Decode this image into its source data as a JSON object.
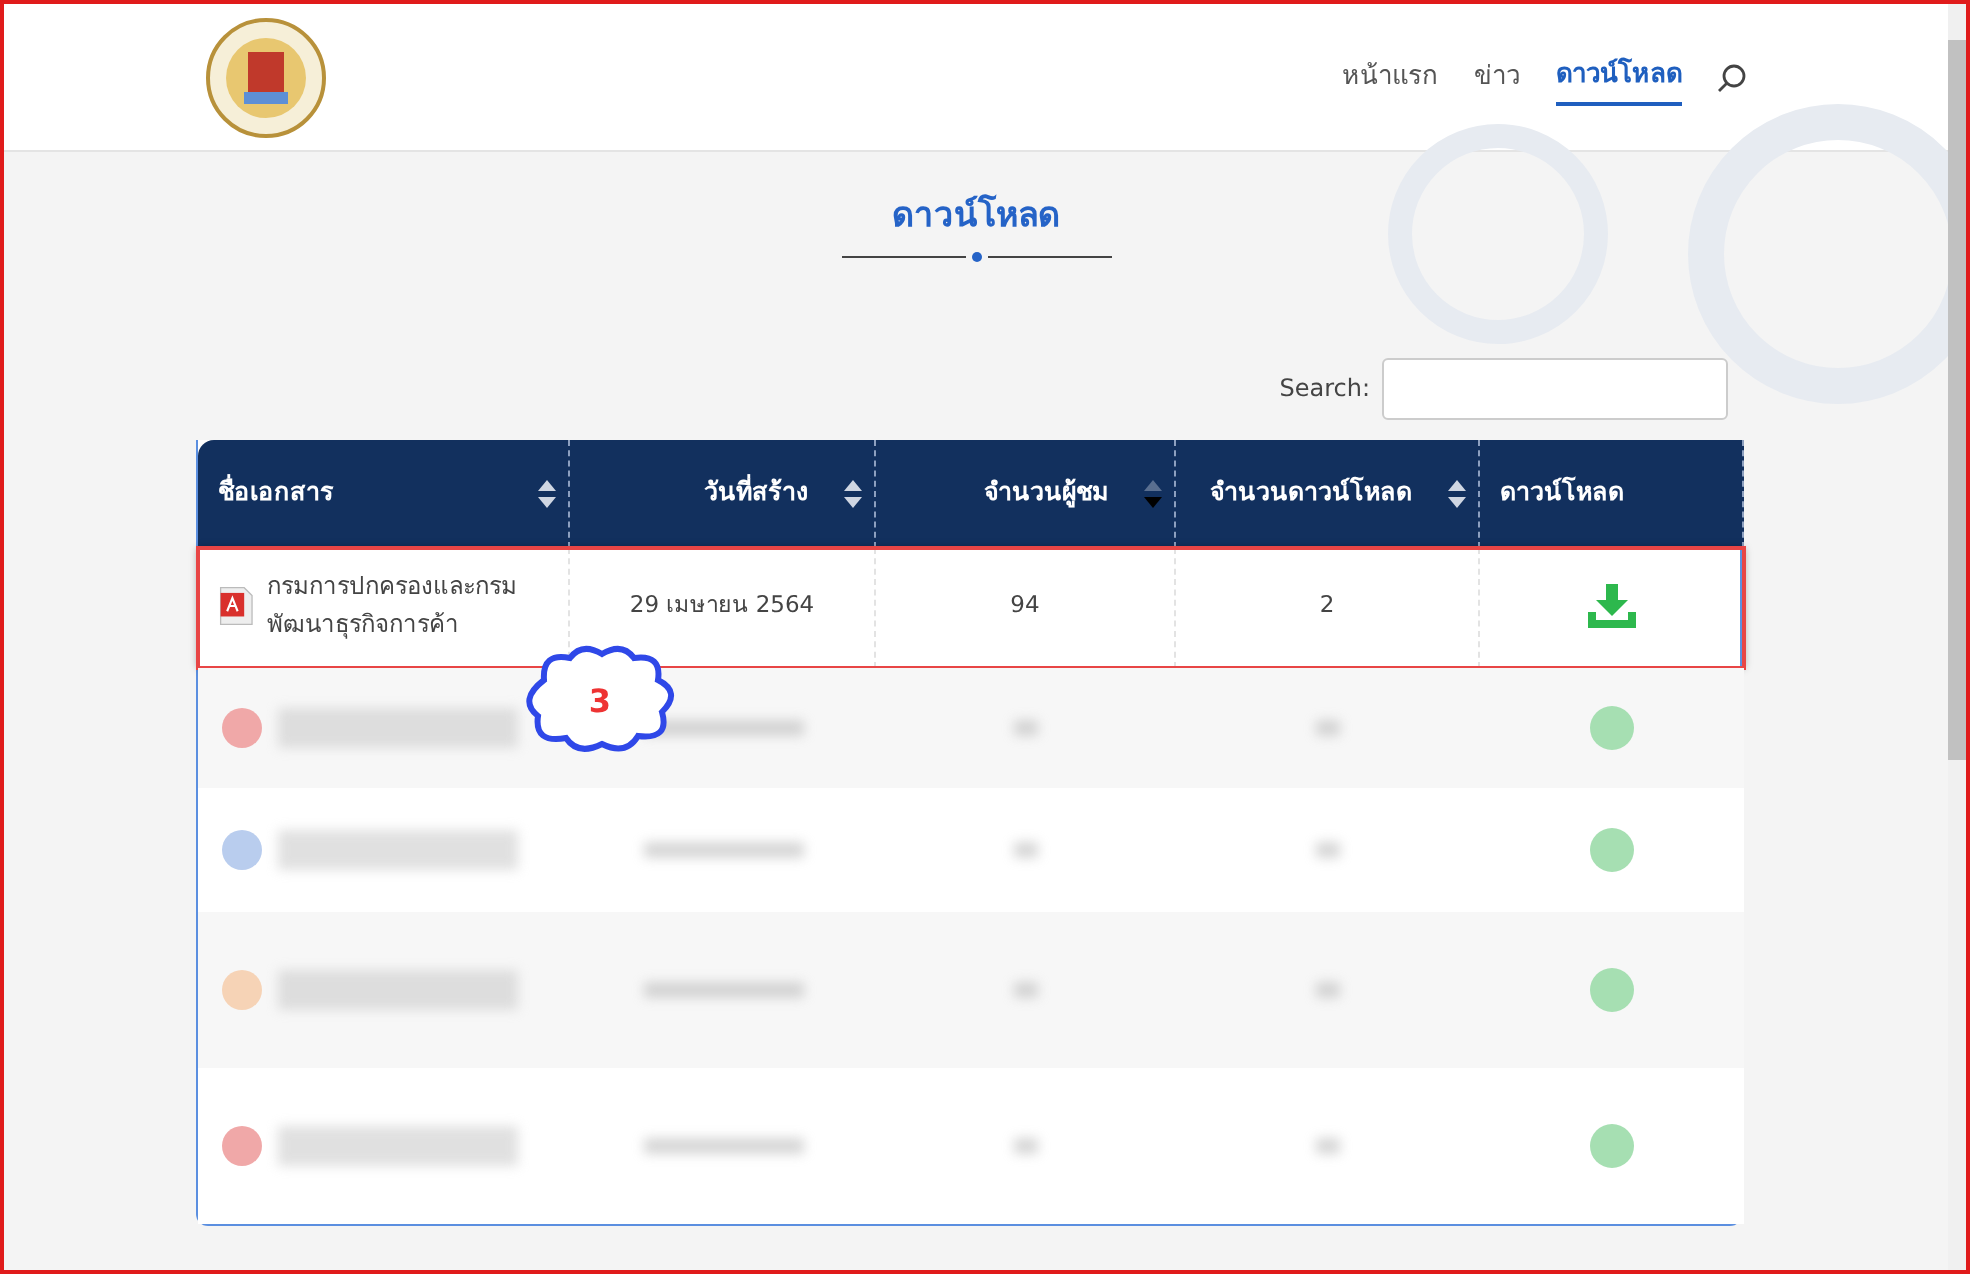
{
  "nav": {
    "items": [
      {
        "label": "หน้าแรก",
        "selected": false
      },
      {
        "label": "ข่าว",
        "selected": false
      },
      {
        "label": "ดาวน์โหลด",
        "selected": true
      }
    ]
  },
  "page_title": "ดาวน์โหลด",
  "search": {
    "label": "Search:"
  },
  "table": {
    "columns": [
      {
        "label": "ชื่อเอกสาร",
        "sortable": true,
        "sorted_desc": false
      },
      {
        "label": "วันที่สร้าง",
        "sortable": true,
        "sorted_desc": false
      },
      {
        "label": "จำนวนผู้ชม",
        "sortable": true,
        "sorted_desc": true
      },
      {
        "label": "จำนวนดาวน์โหลด",
        "sortable": true,
        "sorted_desc": false
      },
      {
        "label": "ดาวน์โหลด",
        "sortable": false
      }
    ],
    "rows": [
      {
        "kind": "clear",
        "name": "กรมการปกครองและกรมพัฒนาธุรกิจการค้า",
        "date": "29 เมษายน 2564",
        "views": "94",
        "downloads": "2",
        "highlighted": true
      },
      {
        "kind": "blurred",
        "color": "#f0a8a8"
      },
      {
        "kind": "blurred",
        "color": "#b9cdee"
      },
      {
        "kind": "blurred",
        "color": "#f6d3b6"
      },
      {
        "kind": "blurred",
        "color": "#f0a8a8"
      }
    ]
  },
  "callout": {
    "label": "3"
  }
}
